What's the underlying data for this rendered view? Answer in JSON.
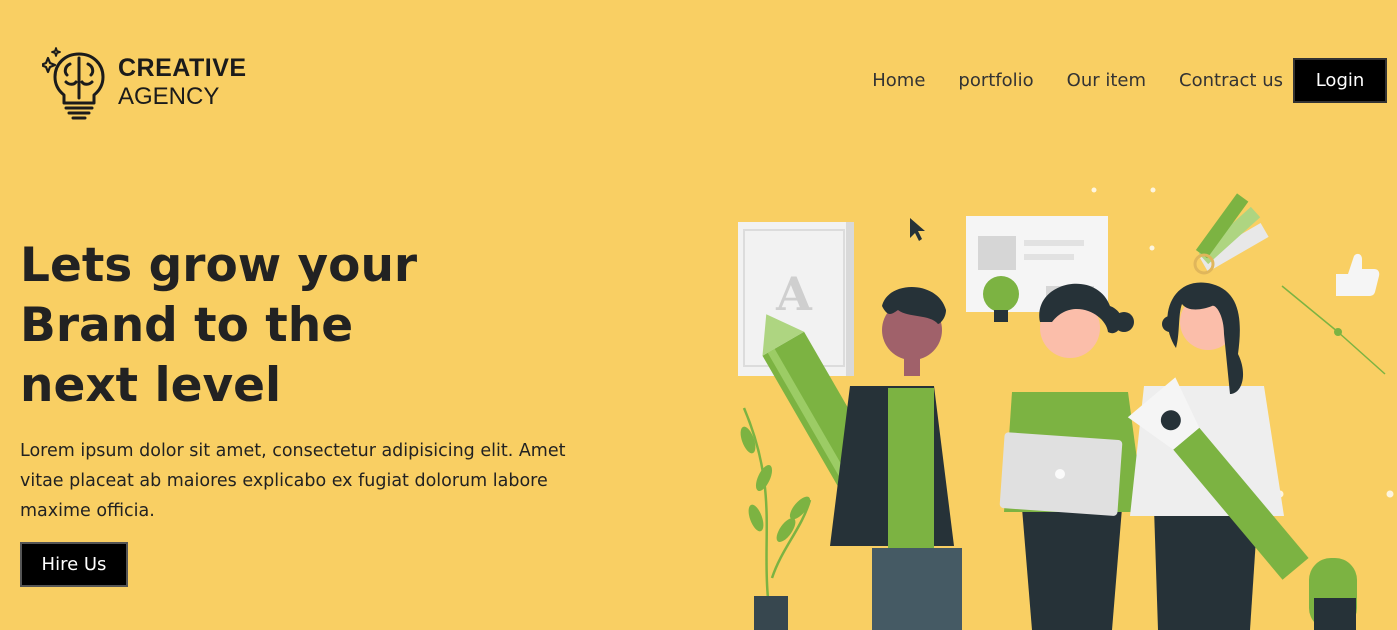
{
  "brand": {
    "name_line1": "CREATIVE",
    "name_line2": "AGENCY",
    "logo_icon": "brain-bulb-icon"
  },
  "nav": {
    "links": [
      "Home",
      "portfolio",
      "Our item",
      "Contract us"
    ],
    "login_label": "Login"
  },
  "hero": {
    "title_lines": [
      "Lets grow your",
      "Brand to the",
      "next level"
    ],
    "description": "Lorem ipsum dolor sit amet, consectetur adipisicing elit. Amet vitae placeat ab maiores explicabo ex fugiat dolorum labore maxime officia.",
    "cta_label": "Hire Us"
  },
  "illustration": {
    "letter_card": "A",
    "description": "team-illustration"
  },
  "colors": {
    "background": "#f9cf63",
    "button": "#000000",
    "text": "#222222",
    "accent_green": "#7cb342",
    "dark": "#263238"
  }
}
